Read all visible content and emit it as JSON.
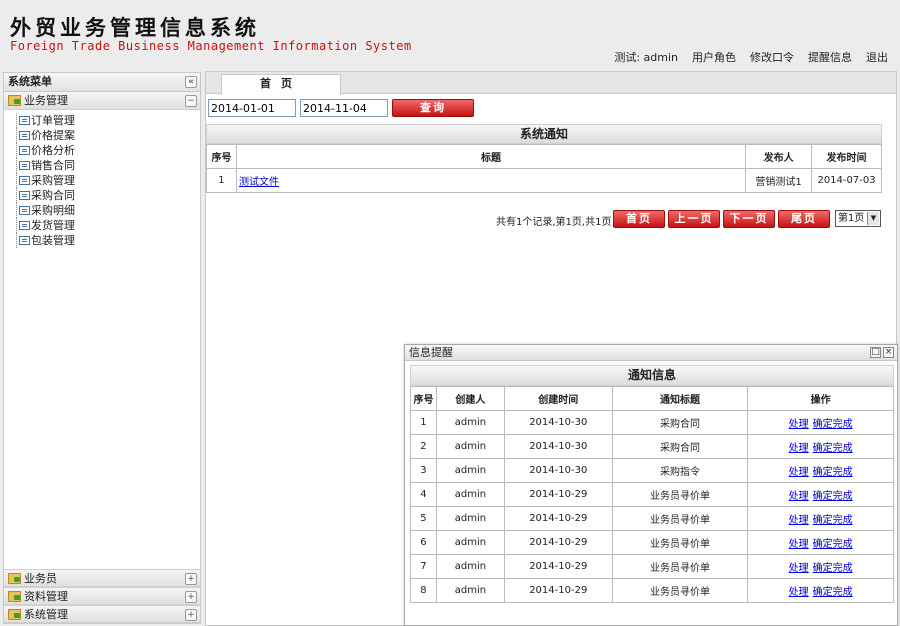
{
  "header": {
    "title_cn": "外贸业务管理信息系统",
    "title_en": "Foreign Trade Business Management Information System",
    "user_label": "测试: admin",
    "links": [
      "用户角色",
      "修改口令",
      "提醒信息",
      "退出"
    ]
  },
  "sidebar": {
    "title": "系统菜单",
    "collapse_icon": "double-chevron-left-icon",
    "open_group": {
      "label": "业务管理",
      "items": [
        "订单管理",
        "价格提案",
        "价格分析",
        "销售合同",
        "采购管理",
        "采购合同",
        "采购明细",
        "发货管理",
        "包装管理"
      ]
    },
    "closed_groups": [
      "业务员",
      "资料管理",
      "系统管理"
    ]
  },
  "main": {
    "tab_label": "首页",
    "filter": {
      "start_date": "2014-01-01",
      "end_date": "2014-11-04",
      "query_label": "查询"
    },
    "notice": {
      "title": "系统通知",
      "headers": [
        "序号",
        "标题",
        "发布人",
        "发布时间"
      ],
      "rows": [
        {
          "no": "1",
          "title": "测试文件",
          "publisher": "营销测试1",
          "time": "2014-07-03"
        }
      ]
    },
    "pager": {
      "info": "共有1个记录,第1页,共1页",
      "first": "首页",
      "prev": "上一页",
      "next": "下一页",
      "last": "尾页",
      "select_value": "第1页"
    }
  },
  "popup": {
    "title": "信息提醒",
    "table_title": "通知信息",
    "headers": [
      "序号",
      "创建人",
      "创建时间",
      "通知标题",
      "操作"
    ],
    "action_handle": "处理",
    "action_confirm": "确定完成",
    "rows": [
      {
        "no": "1",
        "creator": "admin",
        "time": "2014-10-30",
        "subject": "采购合同"
      },
      {
        "no": "2",
        "creator": "admin",
        "time": "2014-10-30",
        "subject": "采购合同"
      },
      {
        "no": "3",
        "creator": "admin",
        "time": "2014-10-30",
        "subject": "采购指令"
      },
      {
        "no": "4",
        "creator": "admin",
        "time": "2014-10-29",
        "subject": "业务员寻价单"
      },
      {
        "no": "5",
        "creator": "admin",
        "time": "2014-10-29",
        "subject": "业务员寻价单"
      },
      {
        "no": "6",
        "creator": "admin",
        "time": "2014-10-29",
        "subject": "业务员寻价单"
      },
      {
        "no": "7",
        "creator": "admin",
        "time": "2014-10-29",
        "subject": "业务员寻价单"
      },
      {
        "no": "8",
        "creator": "admin",
        "time": "2014-10-29",
        "subject": "业务员寻价单"
      }
    ]
  },
  "colors": {
    "accent_red": "#cc1010",
    "button_red": "#d42020",
    "link_blue": "#0000cc"
  }
}
